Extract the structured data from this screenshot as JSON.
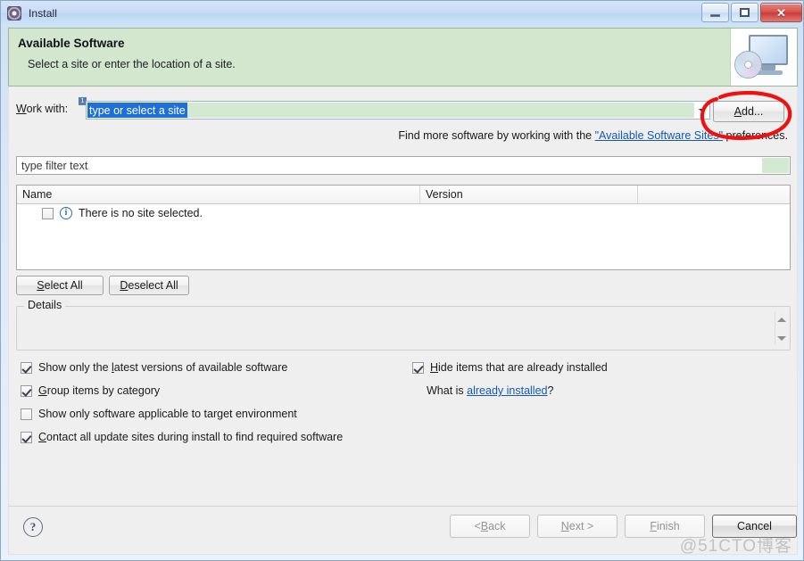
{
  "window": {
    "title": "Install",
    "icon": "install-gear-icon",
    "controls": {
      "minimize": "minimize",
      "maximize": "maximize",
      "close": "close"
    }
  },
  "banner": {
    "title": "Available Software",
    "subtitle": "Select a site or enter the location of a site.",
    "icon": "monitor-cd-icon",
    "bg_color": "#d2e7cd"
  },
  "work_with": {
    "label_prefix": "W",
    "label_rest": "ork with:",
    "badge": "1",
    "combo_value": "type or select a site",
    "dropdown_icon": "chevron-down-icon",
    "add_button": {
      "prefix": "",
      "mnemonic": "A",
      "suffix": "dd..."
    }
  },
  "find_more": {
    "before": "Find more software by working with the ",
    "link": "\"Available Software Sites\"",
    "after": " preferences."
  },
  "filter": {
    "placeholder": "type filter text",
    "value": ""
  },
  "table": {
    "columns": [
      "Name",
      "Version",
      ""
    ],
    "rows": [
      {
        "checked": false,
        "icon": "info-icon",
        "icon_glyph": "i",
        "name": "There is no site selected.",
        "version": ""
      }
    ]
  },
  "selection_buttons": {
    "select_all": {
      "mnemonic": "S",
      "rest": "elect All"
    },
    "deselect_all": {
      "mnemonic": "D",
      "rest": "eselect All"
    }
  },
  "details": {
    "legend": "Details",
    "content": "",
    "scroll_up_icon": "scroll-up-icon",
    "scroll_down_icon": "scroll-down-icon"
  },
  "options": [
    {
      "checked": true,
      "before": "Show only the ",
      "mnemonic": "l",
      "after": "atest versions of available software"
    },
    {
      "checked": true,
      "before": "",
      "mnemonic": "G",
      "after": "roup items by category"
    },
    {
      "checked": false,
      "before": "",
      "mnemonic": "S",
      "after": "how only software applicable to target environment"
    },
    {
      "checked": true,
      "before": "",
      "mnemonic": "C",
      "after": "ontact all update sites during install to find required software"
    }
  ],
  "options_right": {
    "hide_installed": {
      "checked": true,
      "mnemonic": "H",
      "after": "ide items that are already installed"
    },
    "what_is": {
      "before": "What is ",
      "link": "already installed",
      "after": "?"
    }
  },
  "footer": {
    "help_icon": "help-question-icon",
    "back": {
      "text": "< ",
      "mnemonic": "B",
      "rest": "ack",
      "disabled": true
    },
    "next": {
      "text": "",
      "mnemonic": "N",
      "rest": "ext >",
      "disabled": true
    },
    "finish": {
      "text": "",
      "mnemonic": "F",
      "rest": "inish",
      "disabled": true
    },
    "cancel": {
      "text": "Cancel",
      "disabled": false
    }
  },
  "annotation": {
    "type": "hand-drawn-red-circle",
    "color": "#ee1111",
    "target": "Add..."
  },
  "watermark": "@51CTO博客"
}
